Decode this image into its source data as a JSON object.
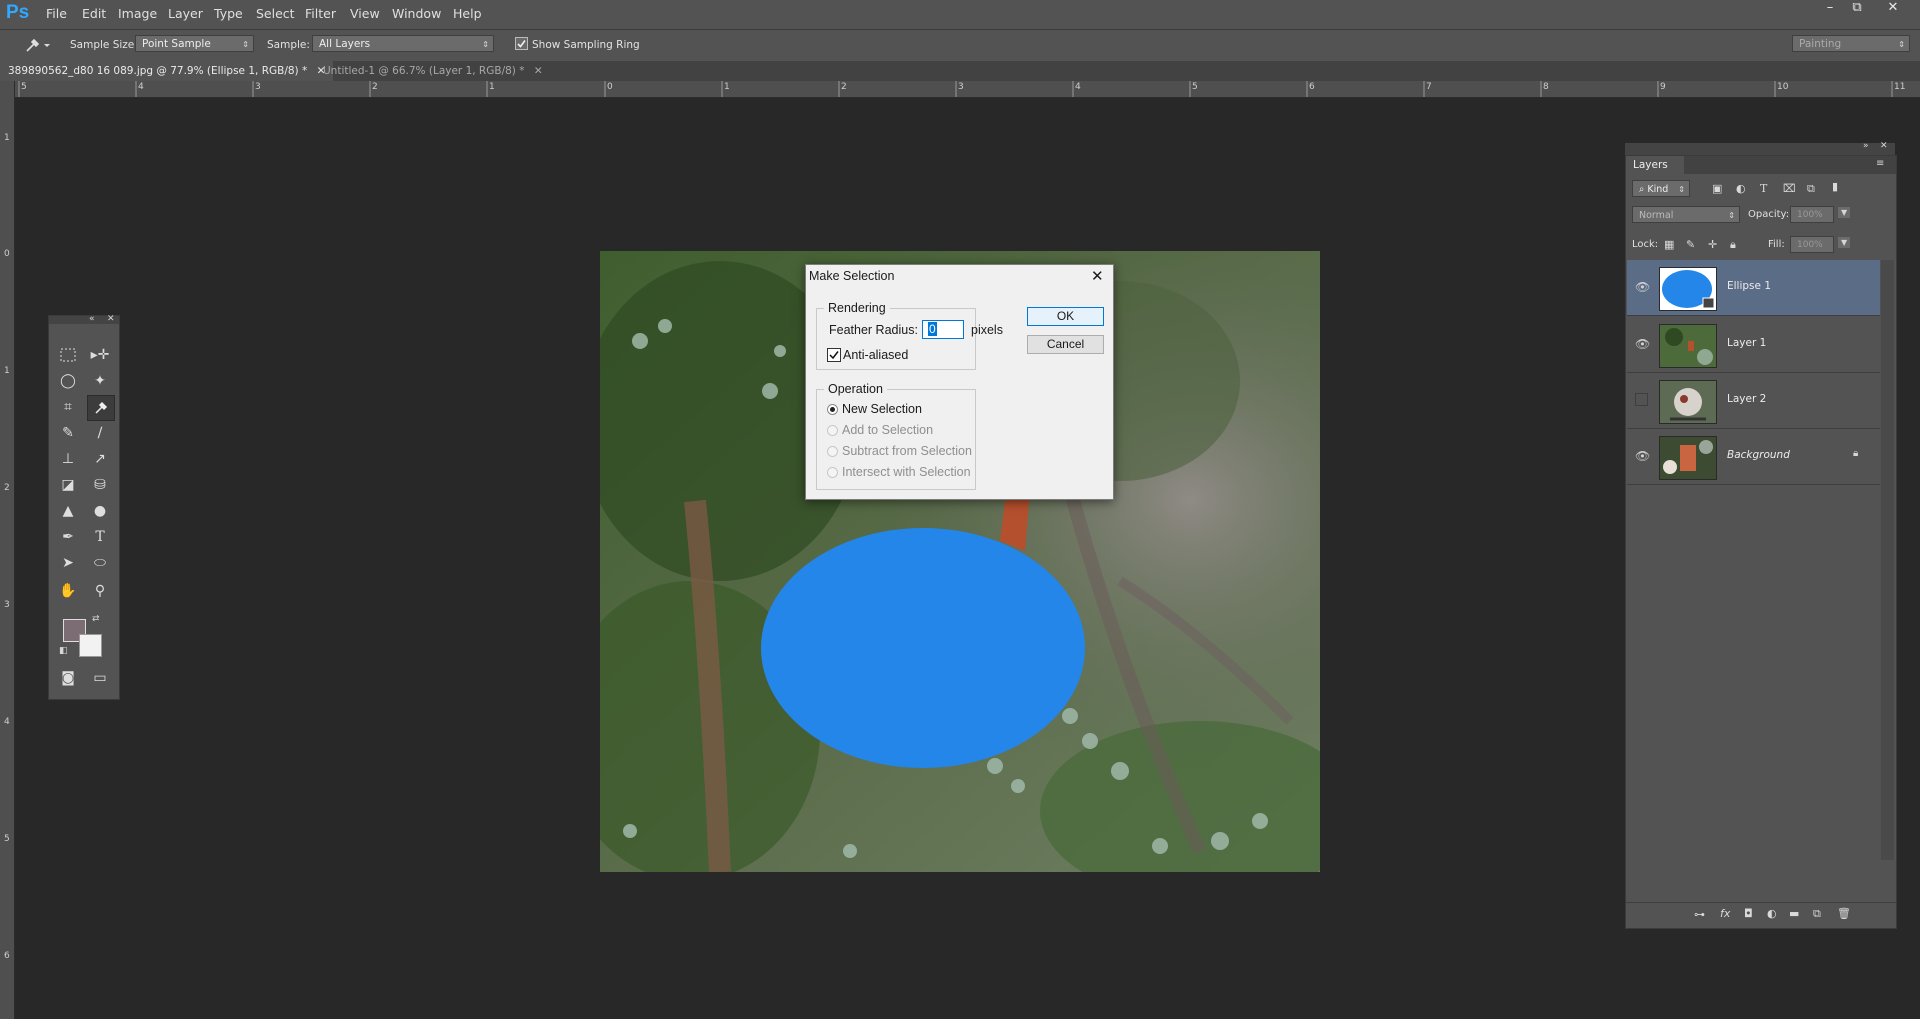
{
  "app": {
    "logo": "Ps"
  },
  "menu": [
    "File",
    "Edit",
    "Image",
    "Layer",
    "Type",
    "Select",
    "Filter",
    "View",
    "Window",
    "Help"
  ],
  "window_controls": {
    "minimize": "–",
    "restore": "⧉",
    "close": "✕"
  },
  "options_bar": {
    "sample_size_label": "Sample Size:",
    "sample_size_value": "Point Sample",
    "sample_label": "Sample:",
    "sample_value": "All Layers",
    "show_ring_label": "Show Sampling Ring",
    "show_ring_checked": true,
    "workspace_value": "Painting"
  },
  "tabs": [
    {
      "title": "389890562_d80 16 089.jpg @ 77.9% (Ellipse 1, RGB/8) *",
      "active": true
    },
    {
      "title": "Untitled-1 @ 66.7% (Layer 1, RGB/8) *",
      "active": false
    }
  ],
  "ruler": {
    "h_ticks": [
      "5",
      "4",
      "3",
      "2",
      "1",
      "0",
      "1",
      "2",
      "3",
      "4",
      "5",
      "6",
      "7",
      "8",
      "9",
      "10",
      "11"
    ],
    "v_ticks": [
      "1",
      "0",
      "1",
      "2",
      "3",
      "4",
      "5",
      "6"
    ]
  },
  "dialog": {
    "title": "Make Selection",
    "rendering_label": "Rendering",
    "feather_label": "Feather Radius:",
    "feather_value": "0",
    "feather_unit": "pixels",
    "anti_aliased_label": "Anti-aliased",
    "anti_aliased_checked": true,
    "operation_label": "Operation",
    "operations": [
      {
        "label": "New Selection",
        "selected": true,
        "enabled": true
      },
      {
        "label": "Add to Selection",
        "selected": false,
        "enabled": false
      },
      {
        "label": "Subtract from Selection",
        "selected": false,
        "enabled": false
      },
      {
        "label": "Intersect with Selection",
        "selected": false,
        "enabled": false
      }
    ],
    "ok_label": "OK",
    "cancel_label": "Cancel"
  },
  "layers_panel": {
    "title": "Layers",
    "filter_label": "Kind",
    "blend_mode": "Normal",
    "opacity_label": "Opacity:",
    "opacity_value": "100%",
    "lock_label": "Lock:",
    "fill_label": "Fill:",
    "fill_value": "100%",
    "layers": [
      {
        "name": "Ellipse 1",
        "visible": true,
        "selected": true
      },
      {
        "name": "Layer 1",
        "visible": true,
        "selected": false
      },
      {
        "name": "Layer 2",
        "visible": false,
        "selected": false
      },
      {
        "name": "Background",
        "visible": true,
        "selected": false,
        "locked": true
      }
    ]
  },
  "colors": {
    "ellipse": "#2486e9",
    "foreground": "#7c6d75",
    "background": "#f2f2f2",
    "selection_blue": "#5b6c86"
  }
}
